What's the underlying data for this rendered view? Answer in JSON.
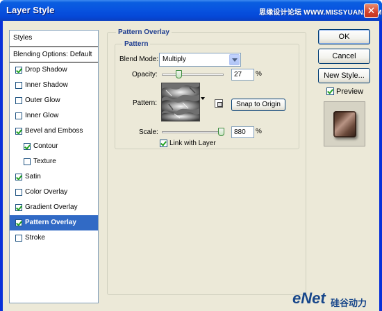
{
  "window": {
    "title": "Layer Style",
    "watermark_top": "思缘设计论坛 WWW.MISSYUAN.COM",
    "close_symbol": "✕"
  },
  "styles_list": {
    "items": [
      {
        "label": "Styles",
        "type": "header",
        "checked": null,
        "selected": false,
        "indent": 0
      },
      {
        "label": "Blending Options: Default",
        "type": "header",
        "checked": null,
        "selected": false,
        "indent": 0
      },
      {
        "label": "Drop Shadow",
        "type": "check",
        "checked": true,
        "selected": false,
        "indent": 0
      },
      {
        "label": "Inner Shadow",
        "type": "check",
        "checked": false,
        "selected": false,
        "indent": 0
      },
      {
        "label": "Outer Glow",
        "type": "check",
        "checked": false,
        "selected": false,
        "indent": 0
      },
      {
        "label": "Inner Glow",
        "type": "check",
        "checked": false,
        "selected": false,
        "indent": 0
      },
      {
        "label": "Bevel and Emboss",
        "type": "check",
        "checked": true,
        "selected": false,
        "indent": 0
      },
      {
        "label": "Contour",
        "type": "check",
        "checked": true,
        "selected": false,
        "indent": 1
      },
      {
        "label": "Texture",
        "type": "check",
        "checked": false,
        "selected": false,
        "indent": 1
      },
      {
        "label": "Satin",
        "type": "check",
        "checked": true,
        "selected": false,
        "indent": 0
      },
      {
        "label": "Color Overlay",
        "type": "check",
        "checked": false,
        "selected": false,
        "indent": 0
      },
      {
        "label": "Gradient Overlay",
        "type": "check",
        "checked": true,
        "selected": false,
        "indent": 0
      },
      {
        "label": "Pattern Overlay",
        "type": "check",
        "checked": true,
        "selected": true,
        "indent": 0
      },
      {
        "label": "Stroke",
        "type": "check",
        "checked": false,
        "selected": false,
        "indent": 0
      }
    ]
  },
  "pattern_overlay": {
    "title": "Pattern Overlay",
    "subgroup_title": "Pattern",
    "blend_mode_label": "Blend Mode:",
    "blend_mode_value": "Multiply",
    "opacity_label": "Opacity:",
    "opacity_value": "27",
    "opacity_unit": "%",
    "opacity_fraction": 0.27,
    "pattern_label": "Pattern:",
    "snap_button": "Snap to Origin",
    "scale_label": "Scale:",
    "scale_value": "880",
    "scale_unit": "%",
    "link_label": "Link with Layer",
    "link_checked": true
  },
  "buttons": {
    "ok": "OK",
    "cancel": "Cancel",
    "new_style": "New Style...",
    "preview_label": "Preview",
    "preview_checked": true
  },
  "watermark_bottom": {
    "brand": "eNet",
    "sub": "硅谷动力"
  },
  "colors": {
    "title_bar": "#0a5ee0",
    "selection": "#316ac5",
    "dialog_bg": "#ece9d8",
    "group_title": "#1d3c8f"
  }
}
